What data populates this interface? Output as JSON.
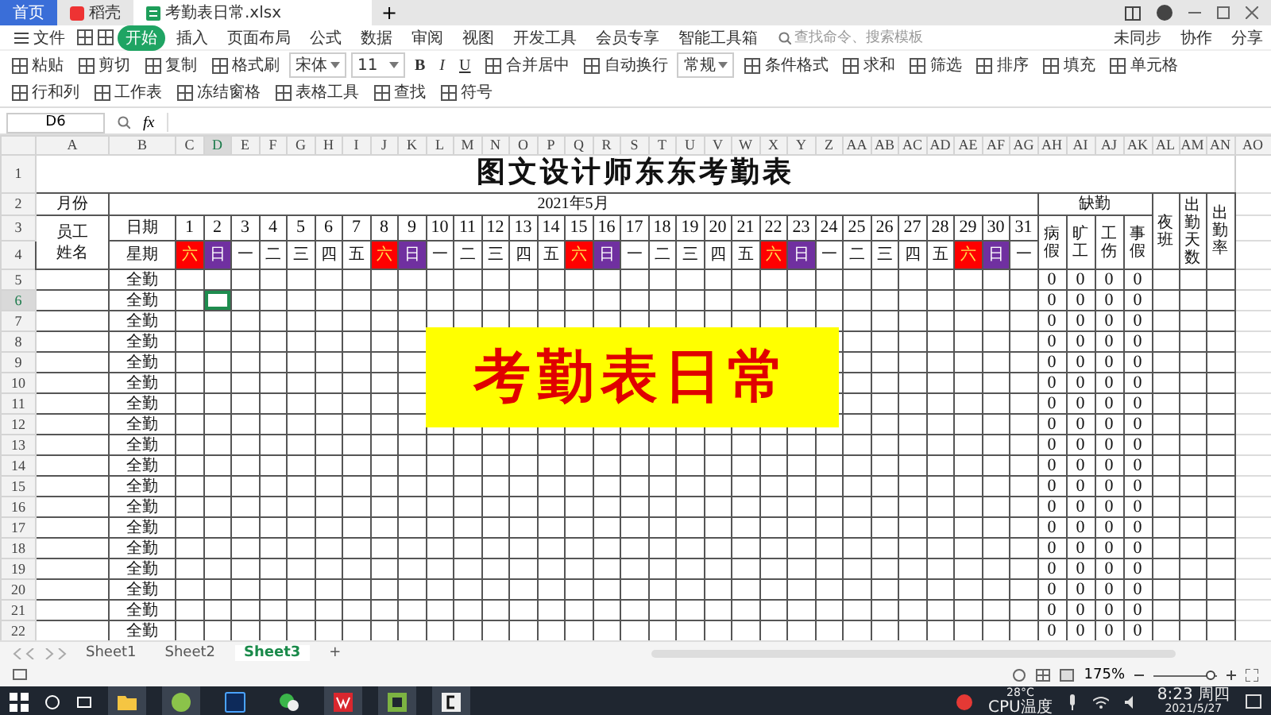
{
  "title_bar": {
    "tabs": [
      {
        "label": "首页",
        "kind": "home",
        "selected": false
      },
      {
        "label": "稻壳",
        "kind": "docer",
        "selected": false
      },
      {
        "label": "考勤表日常.xlsx",
        "kind": "sheet",
        "selected": true
      }
    ],
    "new_tab": "+"
  },
  "menu": {
    "file": "文件",
    "tabs": [
      {
        "label": "开始",
        "selected": true
      },
      {
        "label": "插入",
        "selected": false
      },
      {
        "label": "页面布局",
        "selected": false
      },
      {
        "label": "公式",
        "selected": false
      },
      {
        "label": "数据",
        "selected": false
      },
      {
        "label": "审阅",
        "selected": false
      },
      {
        "label": "视图",
        "selected": false
      },
      {
        "label": "开发工具",
        "selected": false
      },
      {
        "label": "会员专享",
        "selected": false
      },
      {
        "label": "智能工具箱",
        "selected": false
      }
    ],
    "search": {
      "placeholder": "查找命令、搜索模板"
    },
    "actions": [
      "未同步",
      "协作",
      "分享"
    ]
  },
  "toolbar": {
    "items": [
      {
        "kind": "button",
        "label": "粘贴"
      },
      {
        "kind": "button",
        "label": "剪切"
      },
      {
        "kind": "button",
        "label": "复制"
      },
      {
        "kind": "button",
        "label": "格式刷"
      },
      {
        "kind": "select",
        "label": "宋体"
      },
      {
        "kind": "select",
        "label": "11"
      },
      {
        "kind": "bold",
        "label": "B"
      },
      {
        "kind": "italic",
        "label": "I"
      },
      {
        "kind": "underline",
        "label": "U"
      },
      {
        "kind": "button",
        "label": "合并居中"
      },
      {
        "kind": "button",
        "label": "自动换行"
      },
      {
        "kind": "select",
        "label": "常规"
      },
      {
        "kind": "button",
        "label": "条件格式"
      },
      {
        "kind": "button",
        "label": "求和"
      },
      {
        "kind": "button",
        "label": "筛选"
      },
      {
        "kind": "button",
        "label": "排序"
      },
      {
        "kind": "button",
        "label": "填充"
      },
      {
        "kind": "button",
        "label": "单元格"
      },
      {
        "kind": "button",
        "label": "行和列"
      },
      {
        "kind": "button",
        "label": "工作表"
      },
      {
        "kind": "button",
        "label": "冻结窗格"
      },
      {
        "kind": "button",
        "label": "表格工具"
      },
      {
        "kind": "button",
        "label": "查找"
      },
      {
        "kind": "button",
        "label": "符号"
      }
    ]
  },
  "formula_bar": {
    "name_box": "D6",
    "function_label": "fx"
  },
  "sheet": {
    "columns": [
      {
        "label": "A",
        "selected": false
      },
      {
        "label": "B",
        "selected": false
      },
      {
        "label": "C",
        "selected": false
      },
      {
        "label": "D",
        "selected": true
      },
      {
        "label": "E",
        "selected": false
      },
      {
        "label": "F",
        "selected": false
      },
      {
        "label": "G",
        "selected": false
      },
      {
        "label": "H",
        "selected": false
      },
      {
        "label": "I",
        "selected": false
      },
      {
        "label": "J",
        "selected": false
      },
      {
        "label": "K",
        "selected": false
      },
      {
        "label": "L",
        "selected": false
      },
      {
        "label": "M",
        "selected": false
      },
      {
        "label": "N",
        "selected": false
      },
      {
        "label": "O",
        "selected": false
      },
      {
        "label": "P",
        "selected": false
      },
      {
        "label": "Q",
        "selected": false
      },
      {
        "label": "R",
        "selected": false
      },
      {
        "label": "S",
        "selected": false
      },
      {
        "label": "T",
        "selected": false
      },
      {
        "label": "U",
        "selected": false
      },
      {
        "label": "V",
        "selected": false
      },
      {
        "label": "W",
        "selected": false
      },
      {
        "label": "X",
        "selected": false
      },
      {
        "label": "Y",
        "selected": false
      },
      {
        "label": "Z",
        "selected": false
      },
      {
        "label": "AA",
        "selected": false
      },
      {
        "label": "AB",
        "selected": false
      },
      {
        "label": "AC",
        "selected": false
      },
      {
        "label": "AD",
        "selected": false
      },
      {
        "label": "AE",
        "selected": false
      },
      {
        "label": "AF",
        "selected": false
      },
      {
        "label": "AG",
        "selected": false
      },
      {
        "label": "AH",
        "selected": false
      },
      {
        "label": "AI",
        "selected": false
      },
      {
        "label": "AJ",
        "selected": false
      },
      {
        "label": "AK",
        "selected": false
      },
      {
        "label": "AL",
        "selected": false
      },
      {
        "label": "AM",
        "selected": false
      },
      {
        "label": "AN",
        "selected": false
      },
      {
        "label": "AO",
        "selected": false
      }
    ],
    "rows": [
      {
        "label": "1",
        "selected": false
      },
      {
        "label": "2",
        "selected": false
      },
      {
        "label": "3",
        "selected": false
      },
      {
        "label": "4",
        "selected": false
      },
      {
        "label": "5",
        "selected": false
      },
      {
        "label": "6",
        "selected": true
      },
      {
        "label": "7",
        "selected": false
      },
      {
        "label": "8",
        "selected": false
      },
      {
        "label": "9",
        "selected": false
      },
      {
        "label": "10",
        "selected": false
      },
      {
        "label": "11",
        "selected": false
      },
      {
        "label": "12",
        "selected": false
      },
      {
        "label": "13",
        "selected": false
      },
      {
        "label": "14",
        "selected": false
      },
      {
        "label": "15",
        "selected": false
      },
      {
        "label": "16",
        "selected": false
      },
      {
        "label": "17",
        "selected": false
      },
      {
        "label": "18",
        "selected": false
      },
      {
        "label": "19",
        "selected": false
      },
      {
        "label": "20",
        "selected": false
      },
      {
        "label": "21",
        "selected": false
      },
      {
        "label": "22",
        "selected": false
      }
    ],
    "title": "图文设计师东东考勤表",
    "month_label": "月份",
    "month": "2021年5月",
    "name_header": "员工姓名",
    "date_label": "日期",
    "weekday_label": "星期",
    "days": [
      {
        "day": "1",
        "weekday": "六",
        "color": "#ff0000"
      },
      {
        "day": "2",
        "weekday": "日",
        "color": "#7030a0"
      },
      {
        "day": "3",
        "weekday": "一",
        "color": "#ffffff"
      },
      {
        "day": "4",
        "weekday": "二",
        "color": "#ffffff"
      },
      {
        "day": "5",
        "weekday": "三",
        "color": "#ffffff"
      },
      {
        "day": "6",
        "weekday": "四",
        "color": "#ffffff"
      },
      {
        "day": "7",
        "weekday": "五",
        "color": "#ffffff"
      },
      {
        "day": "8",
        "weekday": "六",
        "color": "#ff0000"
      },
      {
        "day": "9",
        "weekday": "日",
        "color": "#7030a0"
      },
      {
        "day": "10",
        "weekday": "一",
        "color": "#ffffff"
      },
      {
        "day": "11",
        "weekday": "二",
        "color": "#ffffff"
      },
      {
        "day": "12",
        "weekday": "三",
        "color": "#ffffff"
      },
      {
        "day": "13",
        "weekday": "四",
        "color": "#ffffff"
      },
      {
        "day": "14",
        "weekday": "五",
        "color": "#ffffff"
      },
      {
        "day": "15",
        "weekday": "六",
        "color": "#ff0000"
      },
      {
        "day": "16",
        "weekday": "日",
        "color": "#7030a0"
      },
      {
        "day": "17",
        "weekday": "一",
        "color": "#ffffff"
      },
      {
        "day": "18",
        "weekday": "二",
        "color": "#ffffff"
      },
      {
        "day": "19",
        "weekday": "三",
        "color": "#ffffff"
      },
      {
        "day": "20",
        "weekday": "四",
        "color": "#ffffff"
      },
      {
        "day": "21",
        "weekday": "五",
        "color": "#ffffff"
      },
      {
        "day": "22",
        "weekday": "六",
        "color": "#ff0000"
      },
      {
        "day": "23",
        "weekday": "日",
        "color": "#7030a0"
      },
      {
        "day": "24",
        "weekday": "一",
        "color": "#ffffff"
      },
      {
        "day": "25",
        "weekday": "二",
        "color": "#ffffff"
      },
      {
        "day": "26",
        "weekday": "三",
        "color": "#ffffff"
      },
      {
        "day": "27",
        "weekday": "四",
        "color": "#ffffff"
      },
      {
        "day": "28",
        "weekday": "五",
        "color": "#ffffff"
      },
      {
        "day": "29",
        "weekday": "六",
        "color": "#ff0000"
      },
      {
        "day": "30",
        "weekday": "日",
        "color": "#7030a0"
      },
      {
        "day": "31",
        "weekday": "一",
        "color": "#ffffff"
      }
    ],
    "absence_header": "缺勤",
    "absence_columns": [
      "病假",
      "旷工",
      "工伤",
      "事假"
    ],
    "night_shift": "夜班",
    "attendance_days": "出勤天数",
    "attendance_rate": "出勤率",
    "employees": [
      {
        "status": "全勤",
        "absences": [
          "0",
          "0",
          "0",
          "0"
        ]
      },
      {
        "status": "全勤",
        "absences": [
          "0",
          "0",
          "0",
          "0"
        ]
      },
      {
        "status": "全勤",
        "absences": [
          "0",
          "0",
          "0",
          "0"
        ]
      },
      {
        "status": "全勤",
        "absences": [
          "0",
          "0",
          "0",
          "0"
        ]
      },
      {
        "status": "全勤",
        "absences": [
          "0",
          "0",
          "0",
          "0"
        ]
      },
      {
        "status": "全勤",
        "absences": [
          "0",
          "0",
          "0",
          "0"
        ]
      },
      {
        "status": "全勤",
        "absences": [
          "0",
          "0",
          "0",
          "0"
        ]
      },
      {
        "status": "全勤",
        "absences": [
          "0",
          "0",
          "0",
          "0"
        ]
      },
      {
        "status": "全勤",
        "absences": [
          "0",
          "0",
          "0",
          "0"
        ]
      },
      {
        "status": "全勤",
        "absences": [
          "0",
          "0",
          "0",
          "0"
        ]
      },
      {
        "status": "全勤",
        "absences": [
          "0",
          "0",
          "0",
          "0"
        ]
      },
      {
        "status": "全勤",
        "absences": [
          "0",
          "0",
          "0",
          "0"
        ]
      },
      {
        "status": "全勤",
        "absences": [
          "0",
          "0",
          "0",
          "0"
        ]
      },
      {
        "status": "全勤",
        "absences": [
          "0",
          "0",
          "0",
          "0"
        ]
      },
      {
        "status": "全勤",
        "absences": [
          "0",
          "0",
          "0",
          "0"
        ]
      },
      {
        "status": "全勤",
        "absences": [
          "0",
          "0",
          "0",
          "0"
        ]
      },
      {
        "status": "全勤",
        "absences": [
          "0",
          "0",
          "0",
          "0"
        ]
      },
      {
        "status": "全勤",
        "absences": [
          "0",
          "0",
          "0",
          "0"
        ]
      }
    ],
    "banner": "考勤表日常"
  },
  "sheet_tabs": {
    "tabs": [
      {
        "label": "Sheet1",
        "selected": false
      },
      {
        "label": "Sheet2",
        "selected": false
      },
      {
        "label": "Sheet3",
        "selected": true
      }
    ],
    "add": "+"
  },
  "status_bar": {
    "zoom": "175%",
    "zoom_slider": {
      "level": 0.9
    }
  },
  "taskbar": {
    "temperature": "28°C",
    "sensor": "CPU温度",
    "time": "8:23 周四",
    "date": "2021/5/27"
  }
}
